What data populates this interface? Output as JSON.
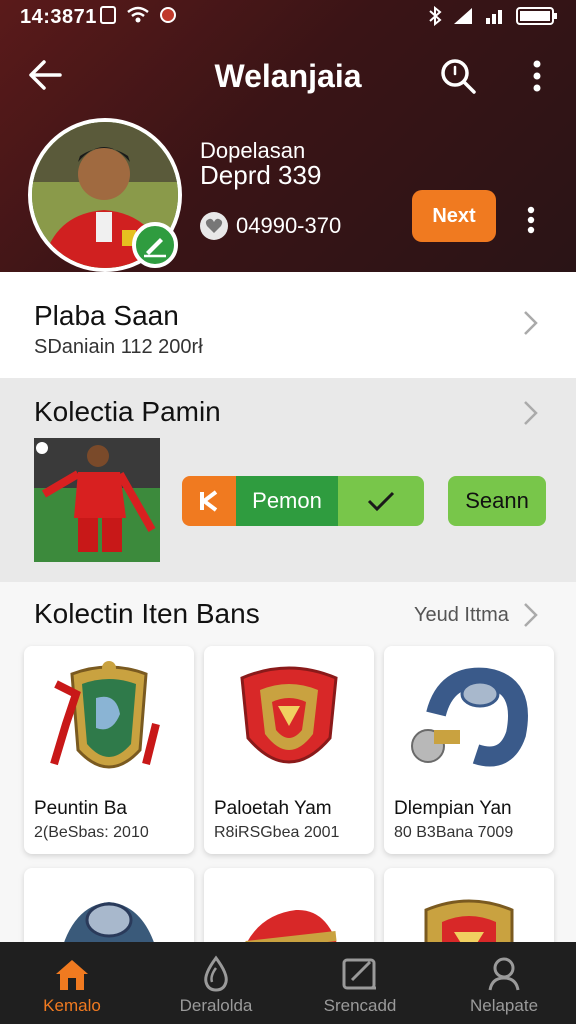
{
  "status_bar": {
    "time": "14:3871",
    "colors": {
      "dot": "#c0392b"
    }
  },
  "header": {
    "title": "Welanjaia",
    "profile": {
      "name": "Dopelasan",
      "subtitle": "Deprd 339",
      "stat": "04990-370"
    },
    "next_label": "Next"
  },
  "section1": {
    "title": "Plaba Saan",
    "subtitle": "SDaniain 112 200rł"
  },
  "section2": {
    "title": "Kolectia Pamin",
    "toggle_label": "Pemon",
    "scan_label": "Seann"
  },
  "section3": {
    "title": "Kolectin Iten Bans",
    "link": "Yeud Ittma",
    "cards": [
      {
        "title": "Peuntin Ba",
        "subtitle": "2(BeSbas: 2010",
        "icon": "shield-dragon-icon"
      },
      {
        "title": "Paloetah Yam",
        "subtitle": "R8iRSGbea 2001",
        "icon": "red-shield-icon"
      },
      {
        "title": "Dlempian Yan",
        "subtitle": "80 B3Bana 7009",
        "icon": "blue-ring-icon"
      },
      {
        "title": "",
        "subtitle": "",
        "icon": "blue-shoulder-armor-icon"
      },
      {
        "title": "",
        "subtitle": "",
        "icon": "red-armor-icon"
      },
      {
        "title": "",
        "subtitle": "",
        "icon": "gold-crest-icon"
      }
    ]
  },
  "bottom_nav": [
    {
      "label": "Kemalo",
      "icon": "home-icon",
      "active": true
    },
    {
      "label": "Deralolda",
      "icon": "drop-icon",
      "active": false
    },
    {
      "label": "Srencadd",
      "icon": "edit-icon",
      "active": false
    },
    {
      "label": "Nelapate",
      "icon": "profile-icon",
      "active": false
    }
  ],
  "colors": {
    "accent": "#f07a20",
    "green": "#2f9c3f",
    "light_green": "#78c64a",
    "header_bg": "#3a1416"
  }
}
